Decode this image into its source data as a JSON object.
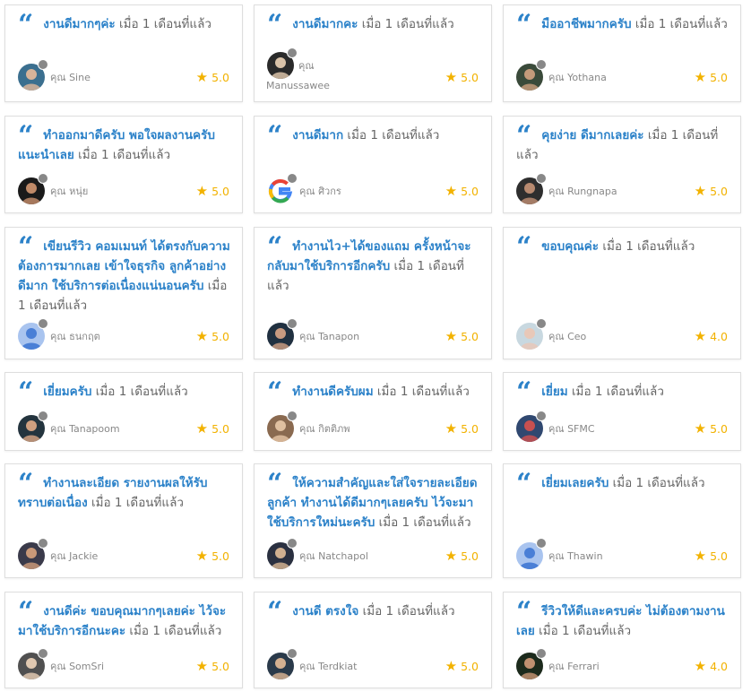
{
  "reviews": [
    {
      "message": "งานดีมากๆค่ะ",
      "time": "เมื่อ 1 เดือนที่แล้ว",
      "user_prefix": "คุณ",
      "user": "Sine",
      "rating": "5.0",
      "avatar": "photo-avatar"
    },
    {
      "message": "งานดีมากคะ",
      "time": "เมื่อ 1 เดือนที่แล้ว",
      "user_prefix": "คุณ",
      "user": "Manussawee",
      "rating": "5.0",
      "avatar": "photo-avatar"
    },
    {
      "message": "มืออาชีพมากครับ",
      "time": "เมื่อ 1 เดือนที่แล้ว",
      "user_prefix": "คุณ",
      "user": "Yothana",
      "rating": "5.0",
      "avatar": "photo-avatar"
    },
    {
      "message": "ทำออกมาดีครับ พอใจผลงานครับ แนะนำเลย",
      "time": "เมื่อ 1 เดือนที่แล้ว",
      "user_prefix": "คุณ",
      "user": "หนุ่ย",
      "rating": "5.0",
      "avatar": "photo-avatar"
    },
    {
      "message": "งานดีมาก",
      "time": "เมื่อ 1 เดือนที่แล้ว",
      "user_prefix": "คุณ",
      "user": "ศิวกร",
      "rating": "5.0",
      "avatar": "google-icon"
    },
    {
      "message": "คุยง่าย ดีมากเลยค่ะ",
      "time": "เมื่อ 1 เดือนที่แล้ว",
      "user_prefix": "คุณ",
      "user": "Rungnapa",
      "rating": "5.0",
      "avatar": "photo-avatar"
    },
    {
      "message": "เขียนรีวิว คอมเมนท์ ได้ตรงกับความต้องการมากเลย เข้าใจธุรกิจ ลูกค้าอย่างดีมาก ใช้บริการต่อเนื่องแน่นอนครับ",
      "time": "เมื่อ 1 เดือนที่แล้ว",
      "user_prefix": "คุณ",
      "user": "ธนกฤต",
      "rating": "5.0",
      "avatar": "default-user-icon"
    },
    {
      "message": "ทำงานไว+ได้ของแถม ครั้งหน้าจะกลับมาใช้บริการอีกครับ",
      "time": "เมื่อ 1 เดือนที่แล้ว",
      "user_prefix": "คุณ",
      "user": "Tanapon",
      "rating": "5.0",
      "avatar": "photo-avatar"
    },
    {
      "message": "ขอบคุณค่ะ",
      "time": "เมื่อ 1 เดือนที่แล้ว",
      "user_prefix": "คุณ",
      "user": "Ceo",
      "rating": "4.0",
      "avatar": "photo-avatar"
    },
    {
      "message": "เยี่ยมครับ",
      "time": "เมื่อ 1 เดือนที่แล้ว",
      "user_prefix": "คุณ",
      "user": "Tanapoom",
      "rating": "5.0",
      "avatar": "photo-avatar"
    },
    {
      "message": "ทำงานดีครับผม",
      "time": "เมื่อ 1 เดือนที่แล้ว",
      "user_prefix": "คุณ",
      "user": "กิตติภพ",
      "rating": "5.0",
      "avatar": "photo-avatar"
    },
    {
      "message": "เยี่ยม",
      "time": "เมื่อ 1 เดือนที่แล้ว",
      "user_prefix": "คุณ",
      "user": "SFMC",
      "rating": "5.0",
      "avatar": "photo-avatar"
    },
    {
      "message": "ทำงานละเอียด รายงานผลให้รับทราบต่อเนื่อง",
      "time": "เมื่อ 1 เดือนที่แล้ว",
      "user_prefix": "คุณ",
      "user": "Jackie",
      "rating": "5.0",
      "avatar": "photo-avatar"
    },
    {
      "message": "ให้ความสำคัญและใส่ใจรายละเอียดลูกค้า ทำงานได้ดีมากๆเลยครับ ไว้จะมาใช้บริการใหม่นะครับ",
      "time": "เมื่อ 1 เดือนที่แล้ว",
      "user_prefix": "คุณ",
      "user": "Natchapol",
      "rating": "5.0",
      "avatar": "photo-avatar"
    },
    {
      "message": "เยี่ยมเลยครับ",
      "time": "เมื่อ 1 เดือนที่แล้ว",
      "user_prefix": "คุณ",
      "user": "Thawin",
      "rating": "5.0",
      "avatar": "default-user-icon"
    },
    {
      "message": "งานดีค่ะ ขอบคุณมากๆเลยค่ะ ไว้จะมาใช้บริการอีกนะคะ",
      "time": "เมื่อ 1 เดือนที่แล้ว",
      "user_prefix": "คุณ",
      "user": "SomSri",
      "rating": "5.0",
      "avatar": "photo-avatar"
    },
    {
      "message": "งานดี ตรงใจ",
      "time": "เมื่อ 1 เดือนที่แล้ว",
      "user_prefix": "คุณ",
      "user": "Terdkiat",
      "rating": "5.0",
      "avatar": "photo-avatar"
    },
    {
      "message": "รีวิวให้ดีและครบค่ะ ไม่ต้องตามงานเลย",
      "time": "เมื่อ 1 เดือนที่แล้ว",
      "user_prefix": "คุณ",
      "user": "Ferrari",
      "rating": "4.0",
      "avatar": "photo-avatar"
    }
  ],
  "colors": {
    "accent": "#2c82c9",
    "star": "#f2b200",
    "status_dot": "#888888"
  },
  "icons": {
    "quote": "quote-icon",
    "star": "star-icon",
    "status": "status-dot-icon"
  }
}
